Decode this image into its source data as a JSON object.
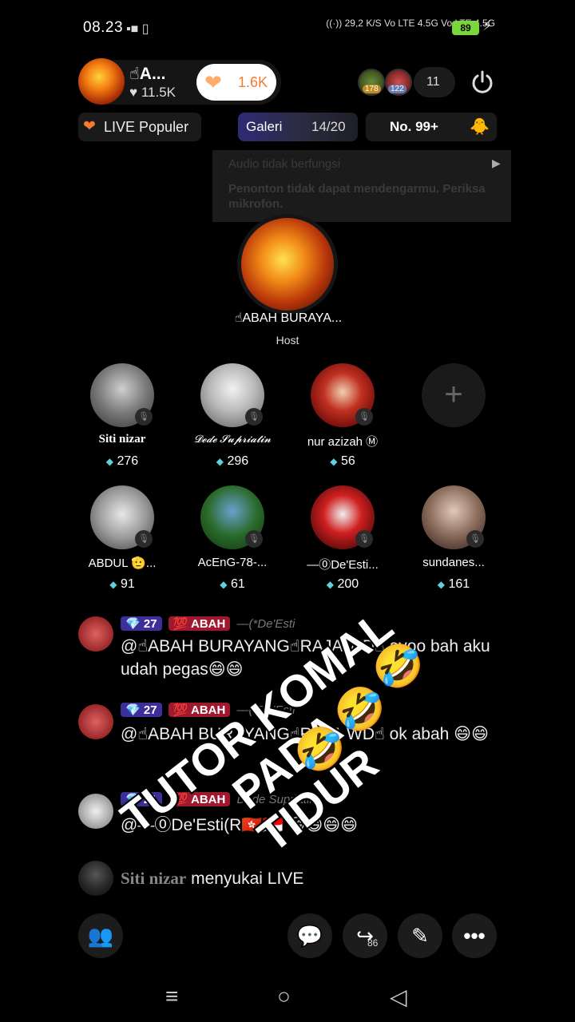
{
  "status_bar": {
    "time": "08.23",
    "net_speed": "29,2 K/S",
    "signal_1": "Vo LTE 4.5G",
    "signal_2": "Vo LTE 4.5G",
    "battery": "89"
  },
  "host_header": {
    "name": "☝A...",
    "likes": "♥ 11.5K",
    "like_count": "1.6K",
    "viewer_badge_1": "178",
    "viewer_badge_2": "122",
    "viewer_count": "11"
  },
  "tags": {
    "live_populer": "LIVE Populer",
    "galeri_label": "Galeri",
    "galeri_count": "14/20",
    "rank": "No. 99+"
  },
  "audio_warning": {
    "title": "Audio tidak berfungsi",
    "body": "Penonton tidak dapat mendengarmu. Periksa mikrofon."
  },
  "host": {
    "name": "☝ABAH BURAYA...",
    "label": "Host"
  },
  "guests": [
    {
      "name": "Siti nizar",
      "score": "276"
    },
    {
      "name": "𝓓𝓮𝓭𝓮 𝓢𝓾𝓹𝓻𝓲𝓪𝓽𝓲𝓷",
      "score": "296"
    },
    {
      "name": "nur azizah Ⓜ",
      "score": "56"
    },
    {
      "name": "ABDUL 🫡...",
      "score": "91"
    },
    {
      "name": "AcEnG-78-...",
      "score": "61"
    },
    {
      "name": "—⓪De'Esti...",
      "score": "200"
    },
    {
      "name": "sundanes...",
      "score": "161"
    }
  ],
  "chat": [
    {
      "level": "27",
      "family": "ABAH",
      "sender": "—(*De'Esti",
      "message": "@☝ABAH BURAYANG☝RAJA WD☝ ayoo bah aku udah pegas😄😄"
    },
    {
      "level": "27",
      "family": "ABAH",
      "sender": "—(*De'Esti",
      "message": "@☝ABAH BURAYANG☝RAJA WD☝ ok abah 😄😄"
    },
    {
      "level": "21",
      "family": "ABAH",
      "sender": "Dede Supriatin",
      "message": "@—⓪De'Esti(R🇭🇰🇮🇩 😄😄😄😄"
    }
  ],
  "like_notice": {
    "user": "Siti nizar",
    "text": " menyukai LIVE"
  },
  "overlay": {
    "line1": "TUTOR KOMAL PADA",
    "line2": "TIDUR"
  },
  "toolbar": {
    "share_count": "86"
  },
  "colors": {
    "accent_orange": "#f47b30",
    "diamond": "#5ed0e0",
    "level_badge": "#3e2e9a",
    "family_badge": "#a0182d"
  }
}
